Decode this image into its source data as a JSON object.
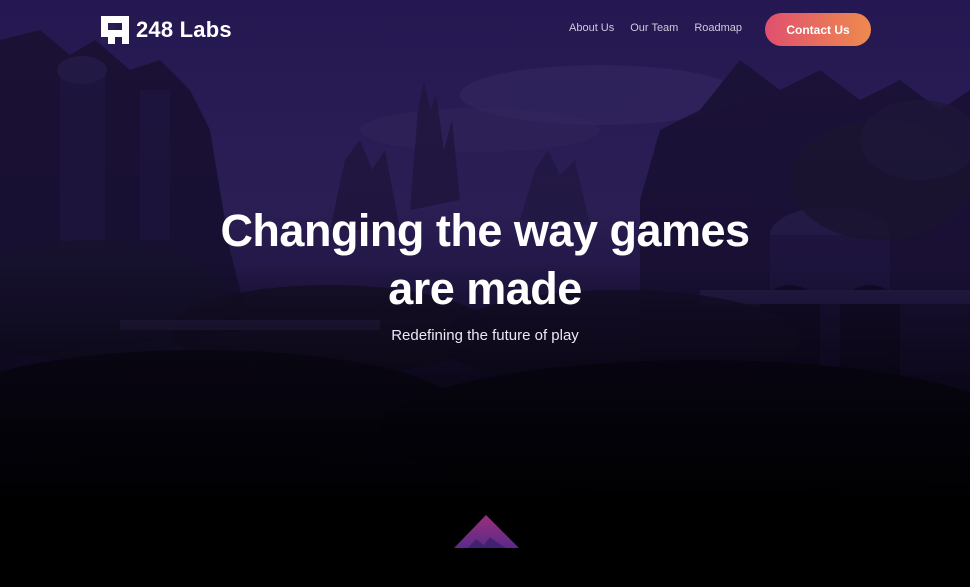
{
  "brand": {
    "name": "248 Labs",
    "logo_icon": "pixel-staircase-logo"
  },
  "nav": {
    "links": [
      "About Us",
      "Our Team",
      "Roadmap"
    ],
    "cta_label": "Contact Us"
  },
  "hero": {
    "headline_line1": "Changing the way games",
    "headline_line2": "are made",
    "subheadline": "Redefining the future of play"
  },
  "colors": {
    "background": "#000000",
    "overlay": "#1e1240",
    "cta_gradient_start": "#e0506e",
    "cta_gradient_end": "#ee8a4e",
    "peak_icon": "#7a2a8c"
  }
}
